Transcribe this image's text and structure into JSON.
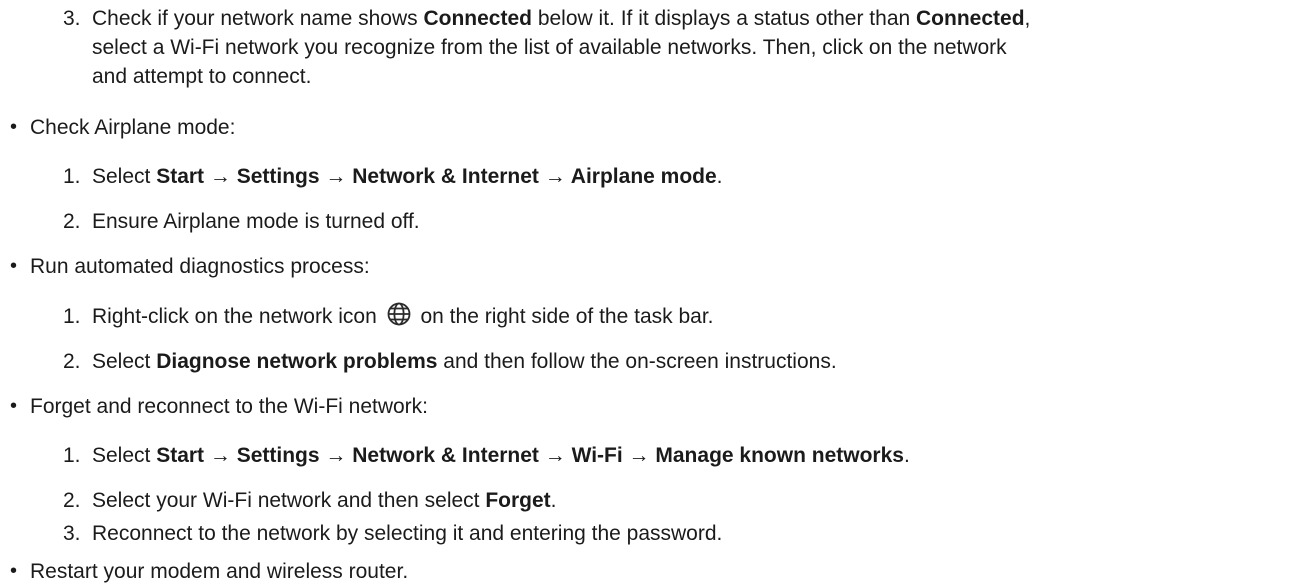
{
  "step_a3": {
    "number": "3.",
    "line1_a": "Check if your network name shows ",
    "line1_b": "Connected",
    "line1_c": " below it. If it displays a status other than ",
    "line1_d": "Connected",
    "line1_e": ",",
    "line2": "select a Wi-Fi network you recognize from the list of available networks. Then, click on the network",
    "line3": "and attempt to connect."
  },
  "airplane": {
    "bullet": "•",
    "title": "Check Airplane mode:",
    "step1_number": "1.",
    "step1_prefix": "Select ",
    "step1_path": "Start → Settings → Network & Internet → Airplane mode",
    "step1_suffix": ".",
    "step2_number": "2.",
    "step2_text": "Ensure Airplane mode is turned off."
  },
  "diagnostics": {
    "bullet": "•",
    "title": "Run automated diagnostics process:",
    "step1_number": "1.",
    "step1_prefix": "Right-click on the network icon",
    "step1_icon": "globe-network-icon",
    "step1_suffix": "on the right side of the task bar.",
    "step2_number": "2.",
    "step2_prefix": "Select ",
    "step2_bold": "Diagnose network problems",
    "step2_suffix": " and then follow the on-screen instructions."
  },
  "forget": {
    "bullet": "•",
    "title": "Forget and reconnect to the Wi-Fi network:",
    "step1_number": "1.",
    "step1_prefix": "Select ",
    "step1_path": "Start → Settings → Network & Internet → Wi-Fi → Manage known networks",
    "step1_suffix": ".",
    "step2_number": "2.",
    "step2_prefix": "Select your Wi-Fi network and then select ",
    "step2_bold": "Forget",
    "step2_suffix": ".",
    "step3_number": "3.",
    "step3_text": "Reconnect to the network by selecting it and entering the password."
  },
  "restart": {
    "bullet": "•",
    "title": "Restart your modem and wireless router."
  }
}
